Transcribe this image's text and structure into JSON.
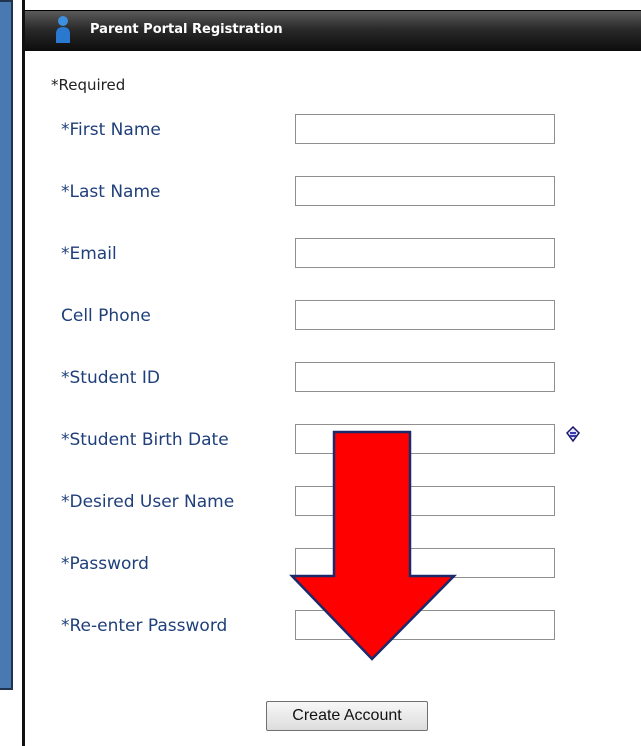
{
  "panel": {
    "title": "Parent Portal Registration"
  },
  "form": {
    "required_note": "*Required",
    "fields": [
      {
        "label": "*First Name",
        "value": ""
      },
      {
        "label": "*Last Name",
        "value": ""
      },
      {
        "label": "*Email",
        "value": ""
      },
      {
        "label": "Cell Phone",
        "value": ""
      },
      {
        "label": "*Student ID",
        "value": ""
      },
      {
        "label": "*Student Birth Date",
        "value": ""
      },
      {
        "label": "*Desired User Name",
        "value": ""
      },
      {
        "label": "*Password",
        "value": ""
      },
      {
        "label": "*Re-enter Password",
        "value": ""
      }
    ],
    "submit_label": "Create Account"
  },
  "colors": {
    "label_text": "#1f3f7a",
    "titlebar": "#1a1a1a",
    "arrow": "#ff0000",
    "frame_blue": "#4a78b0"
  },
  "icons": {
    "titlebar": "user-icon",
    "birth_date": "calendar-icon",
    "annotation": "down-arrow"
  }
}
